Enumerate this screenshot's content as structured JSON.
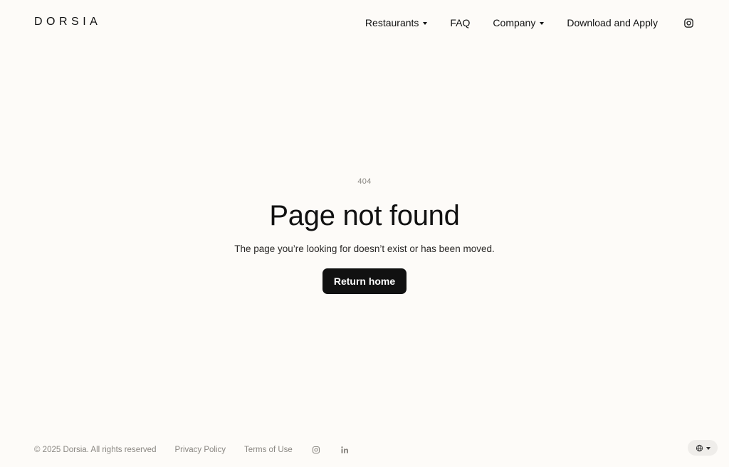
{
  "brand": {
    "logo_text": "DORSIA"
  },
  "nav": {
    "items": [
      {
        "label": "Restaurants",
        "has_dropdown": true
      },
      {
        "label": "FAQ",
        "has_dropdown": false
      },
      {
        "label": "Company",
        "has_dropdown": true
      },
      {
        "label": "Download and Apply",
        "has_dropdown": false
      }
    ],
    "social_icon": "instagram-icon"
  },
  "error": {
    "code": "404",
    "title": "Page not found",
    "message": "The page you’re looking for doesn’t exist or has been moved.",
    "button_label": "Return home"
  },
  "footer": {
    "copyright": "© 2025 Dorsia. All rights reserved",
    "links": [
      {
        "label": "Privacy Policy"
      },
      {
        "label": "Terms of Use"
      }
    ],
    "social_icons": [
      "instagram-icon",
      "linkedin-icon"
    ],
    "language_icon": "globe-icon"
  },
  "colors": {
    "background": "#fdfbf8",
    "text_primary": "#111111",
    "text_muted": "#8a8782",
    "button_bg": "#111111",
    "button_text": "#ffffff"
  }
}
